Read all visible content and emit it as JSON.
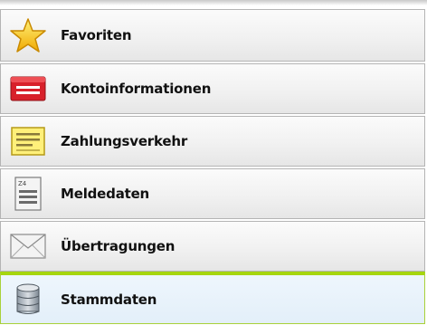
{
  "nav": {
    "items": [
      {
        "label": "Favoriten",
        "icon": "star-icon",
        "active": false
      },
      {
        "label": "Kontoinformationen",
        "icon": "account-card-icon",
        "active": false
      },
      {
        "label": "Zahlungsverkehr",
        "icon": "payment-form-icon",
        "active": false
      },
      {
        "label": "Meldedaten",
        "icon": "report-document-icon",
        "active": false
      },
      {
        "label": "Übertragungen",
        "icon": "envelope-icon",
        "active": false
      },
      {
        "label": "Stammdaten",
        "icon": "database-icon",
        "active": true
      }
    ]
  },
  "colors": {
    "active_accent": "#a6d60f",
    "active_background": "#e3eff9",
    "item_border": "#b4b4b4"
  }
}
